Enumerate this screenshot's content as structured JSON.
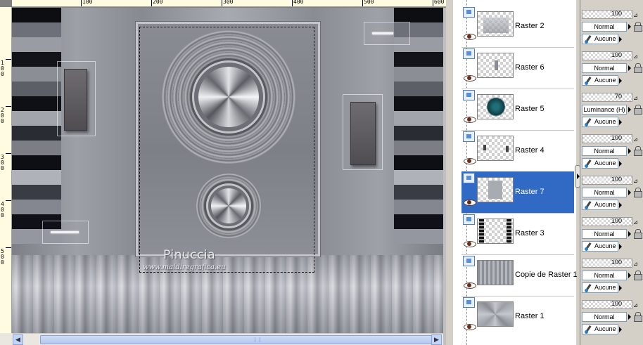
{
  "canvas": {
    "ruler_top_labels": [
      "100",
      "200",
      "300",
      "400",
      "500",
      "600"
    ],
    "ruler_left_labels": [
      "100",
      "200",
      "300",
      "400",
      "500"
    ],
    "watermark_name": "Pinuccia",
    "watermark_url": "www.maidiregrafica.eu",
    "scroll_left": "◀",
    "scroll_right": "▶"
  },
  "layers": [
    {
      "name": "Raster 2",
      "opacity": "100",
      "blend": "Normal",
      "mask": "Aucune",
      "selected": false
    },
    {
      "name": "Raster 6",
      "opacity": "100",
      "blend": "Normal",
      "mask": "Aucune",
      "selected": false
    },
    {
      "name": "Raster 5",
      "opacity": "70",
      "blend": "Luminance (H)",
      "mask": "Aucune",
      "selected": false
    },
    {
      "name": "Raster 4",
      "opacity": "100",
      "blend": "Normal",
      "mask": "Aucune",
      "selected": false
    },
    {
      "name": "Raster 7",
      "opacity": "100",
      "blend": "Normal",
      "mask": "Aucune",
      "selected": true
    },
    {
      "name": "Raster 3",
      "opacity": "100",
      "blend": "Normal",
      "mask": "Aucune",
      "selected": false
    },
    {
      "name": "Copie de Raster 1",
      "opacity": "100",
      "blend": "Normal",
      "mask": "Aucune",
      "selected": false
    },
    {
      "name": "Raster 1",
      "opacity": "100",
      "blend": "Normal",
      "mask": "Aucune",
      "selected": false
    }
  ],
  "colors": {
    "selection_highlight": "#316ac5",
    "palette_background": "#d4d0c8",
    "raster5_thumb_accent": "#1f6f78"
  }
}
